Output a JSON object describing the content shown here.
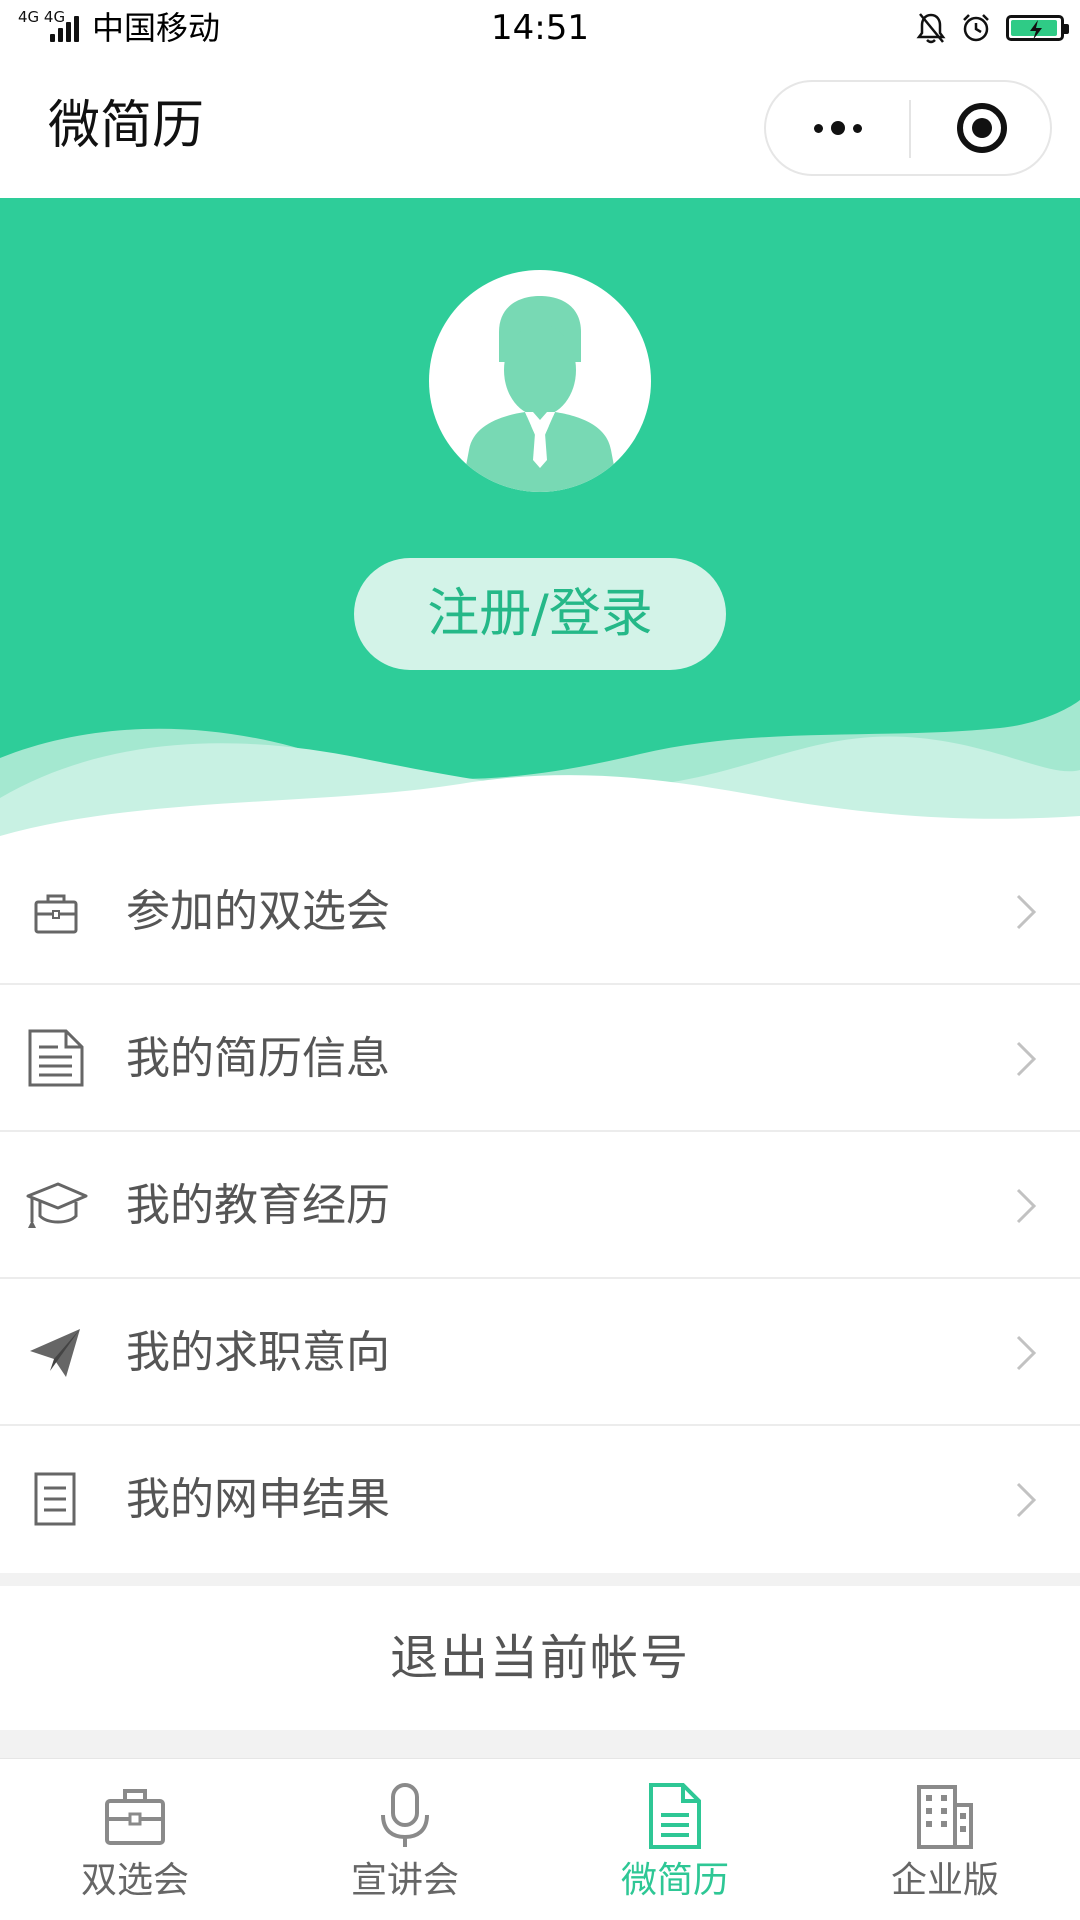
{
  "status_bar": {
    "network": "4G 4G",
    "carrier": "中国移动",
    "time": "14:51",
    "icons": [
      "signal-icon",
      "mute-bell-icon",
      "alarm-icon",
      "battery-charging-icon"
    ],
    "battery_color": "#2fcb86"
  },
  "title_bar": {
    "title": "微简历",
    "capsule_icons": [
      "more-icon",
      "target-icon"
    ]
  },
  "hero": {
    "background_color": "#2ecd99",
    "avatar_icon": "user-avatar-icon",
    "login_label": "注册/登录"
  },
  "menu": {
    "items": [
      {
        "label": "参加的双选会",
        "icon": "briefcase-icon"
      },
      {
        "label": "我的简历信息",
        "icon": "document-icon"
      },
      {
        "label": "我的教育经历",
        "icon": "graduation-cap-icon"
      },
      {
        "label": "我的求职意向",
        "icon": "paper-plane-icon"
      },
      {
        "label": "我的网申结果",
        "icon": "list-icon"
      }
    ],
    "chevron_icon": "chevron-right-icon"
  },
  "logout": {
    "label": "退出当前帐号"
  },
  "tab_bar": {
    "active_color": "#2ec795",
    "tabs": [
      {
        "label": "双选会",
        "icon": "briefcase-icon",
        "active": false
      },
      {
        "label": "宣讲会",
        "icon": "microphone-icon",
        "active": false
      },
      {
        "label": "微简历",
        "icon": "resume-icon",
        "active": true
      },
      {
        "label": "企业版",
        "icon": "building-icon",
        "active": false
      }
    ]
  }
}
